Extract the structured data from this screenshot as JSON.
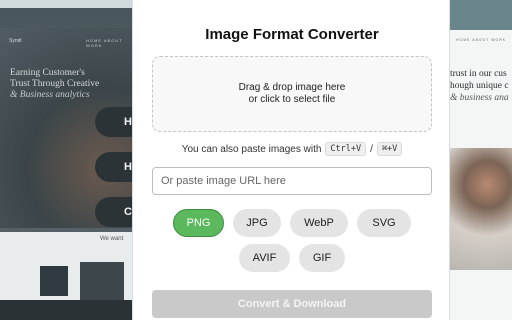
{
  "background_left": {
    "logo": "Syndi",
    "nav": "HOME  ABOUT  WORK",
    "headline_line1": "Earning Customer's",
    "headline_line2": "Trust Through Creative",
    "headline_line3": "& Business analytics",
    "pill_1": "H",
    "pill_2": "H",
    "pill_3": "C",
    "we_want": "We want"
  },
  "background_right": {
    "nav": "HOME  ABOUT  WORK",
    "line1": "trust in our cus",
    "line2": "hough unique c",
    "line3": "& business ana"
  },
  "converter": {
    "title": "Image Format Converter",
    "dropzone_line1": "Drag & drop image here",
    "dropzone_line2": "or click to select file",
    "paste_hint": "You can also paste images with",
    "shortcut_win": "Ctrl+V",
    "shortcut_sep": "/",
    "shortcut_mac": "⌘+V",
    "url_placeholder": "Or paste image URL here",
    "formats": [
      "PNG",
      "JPG",
      "WebP",
      "SVG",
      "AVIF",
      "GIF"
    ],
    "selected_format": "PNG",
    "convert_label": "Convert & Download",
    "colors": {
      "selected": "#5cb85c",
      "format_bg": "#e4e4e4",
      "convert_disabled": "#c9c9c9"
    }
  }
}
